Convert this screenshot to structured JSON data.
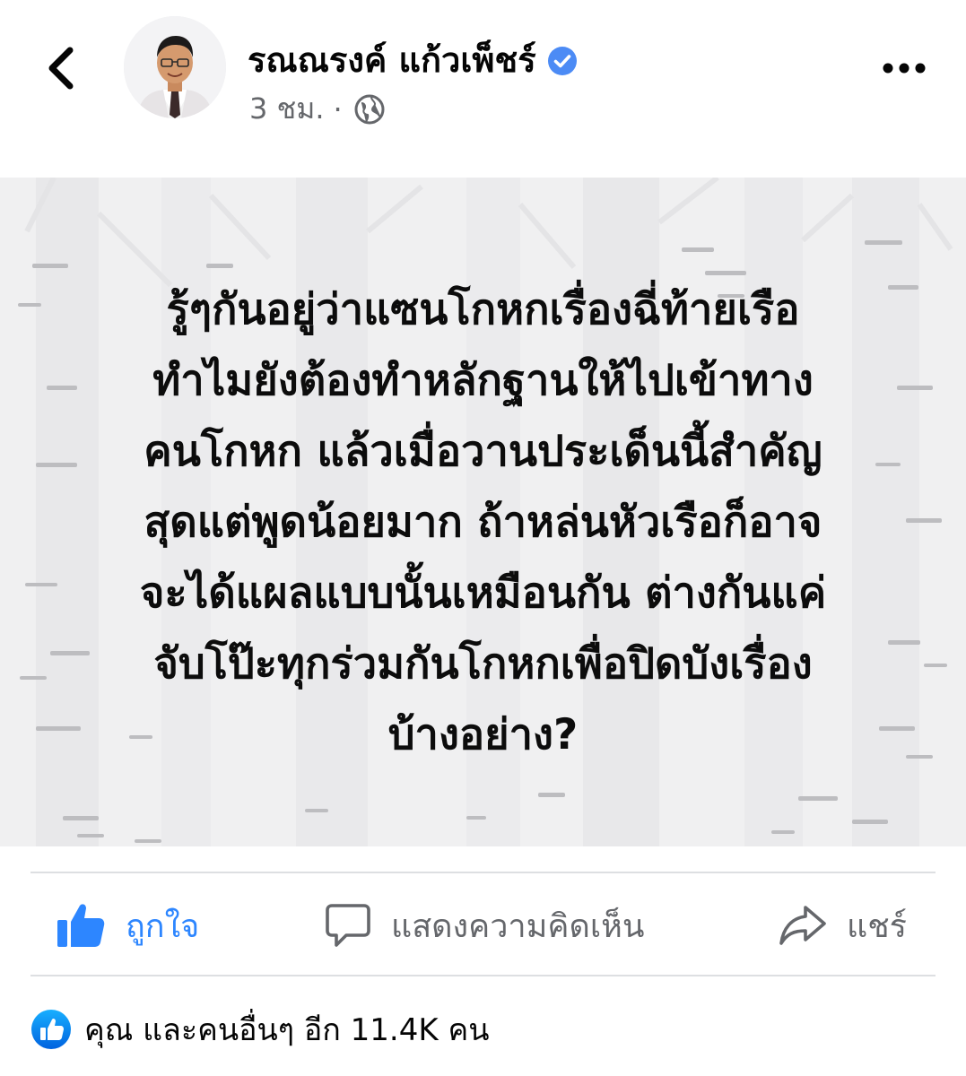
{
  "post": {
    "author_name": "รณณรงค์ แก้วเพ็ชร์",
    "time": "3 ชม.",
    "separator": "·",
    "verified_icon": "verified-badge-icon",
    "privacy_icon": "globe-icon",
    "image_text": "รู้ๆกันอยู่ว่าแซนโกหกเรื่องฉี่ท้ายเรือ\nทำไมยังต้องทำหลักฐานให้ไปเข้าทาง\nคนโกหก แล้วเมื่อวานประเด็นนี้สำคัญ\nสุดแต่พูดน้อยมาก ถ้าหล่นหัวเรือก็อาจ\nจะได้แผลแบบนั้นเหมือนกัน ต่างกันแค่\nจับโป๊ะทุกร่วมกันโกหกเพื่อปิดบังเรื่อง\nบ้างอย่าง?"
  },
  "actions": {
    "like_label": "ถูกใจ",
    "comment_label": "แสดงความคิดเห็น",
    "share_label": "แชร์"
  },
  "reactions": {
    "summary": "คุณ และคนอื่นๆ อีก 11.4K คน"
  },
  "colors": {
    "accent": "#2d86ff",
    "verified": "#4c8bf5",
    "secondary_text": "#65676b",
    "image_bg": "#f0f0f1"
  }
}
